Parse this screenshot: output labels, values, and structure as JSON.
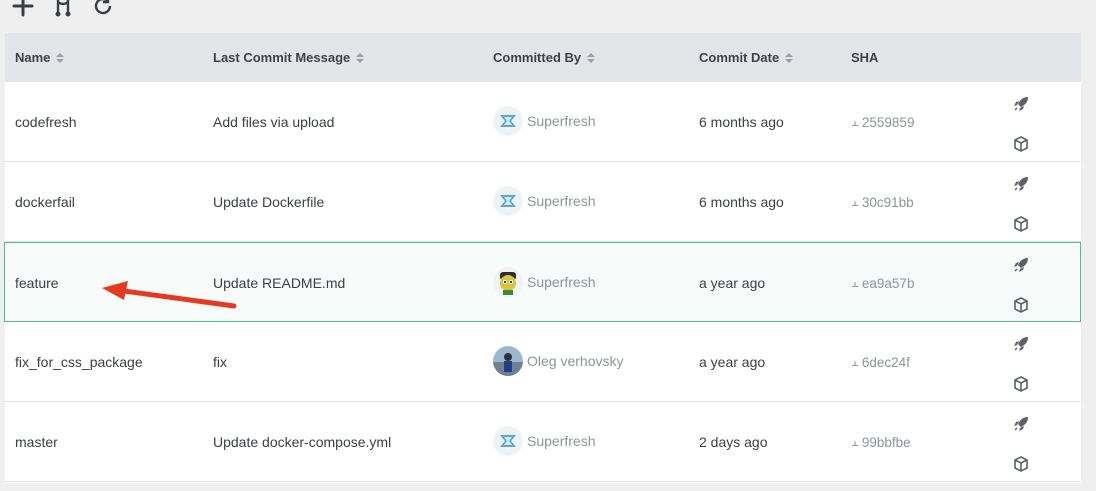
{
  "toolbar": {
    "icons": [
      "plus-icon",
      "merge-icon",
      "refresh-icon"
    ]
  },
  "table": {
    "headers": {
      "name": "Name",
      "message": "Last Commit Message",
      "committed_by": "Committed By",
      "date": "Commit Date",
      "sha": "SHA"
    },
    "rows": [
      {
        "name": "codefresh",
        "message": "Add files via upload",
        "author": "Superfresh",
        "avatar": "superfresh-logo",
        "date": "6 months ago",
        "sha": "2559859"
      },
      {
        "name": "dockerfail",
        "message": "Update Dockerfile",
        "author": "Superfresh",
        "avatar": "superfresh-logo",
        "date": "6 months ago",
        "sha": "30c91bb"
      },
      {
        "name": "feature",
        "message": "Update README.md",
        "author": "Superfresh",
        "avatar": "cartoon-character",
        "date": "a year ago",
        "sha": "ea9a57b",
        "selected": true
      },
      {
        "name": "fix_for_css_package",
        "message": "fix",
        "author": "Oleg verhovsky",
        "avatar": "person-photo",
        "date": "a year ago",
        "sha": "6dec24f"
      },
      {
        "name": "master",
        "message": "Update docker-compose.yml",
        "author": "Superfresh",
        "avatar": "superfresh-logo",
        "date": "2 days ago",
        "sha": "99bbfbe"
      }
    ],
    "row_actions": [
      "rocket-icon",
      "package-icon"
    ]
  },
  "annotation": {
    "type": "red-arrow",
    "color": "#e53a1f",
    "points_to": "feature"
  },
  "colors": {
    "selected_border": "#4cbf9a",
    "header_bg": "#e4e5e8"
  }
}
